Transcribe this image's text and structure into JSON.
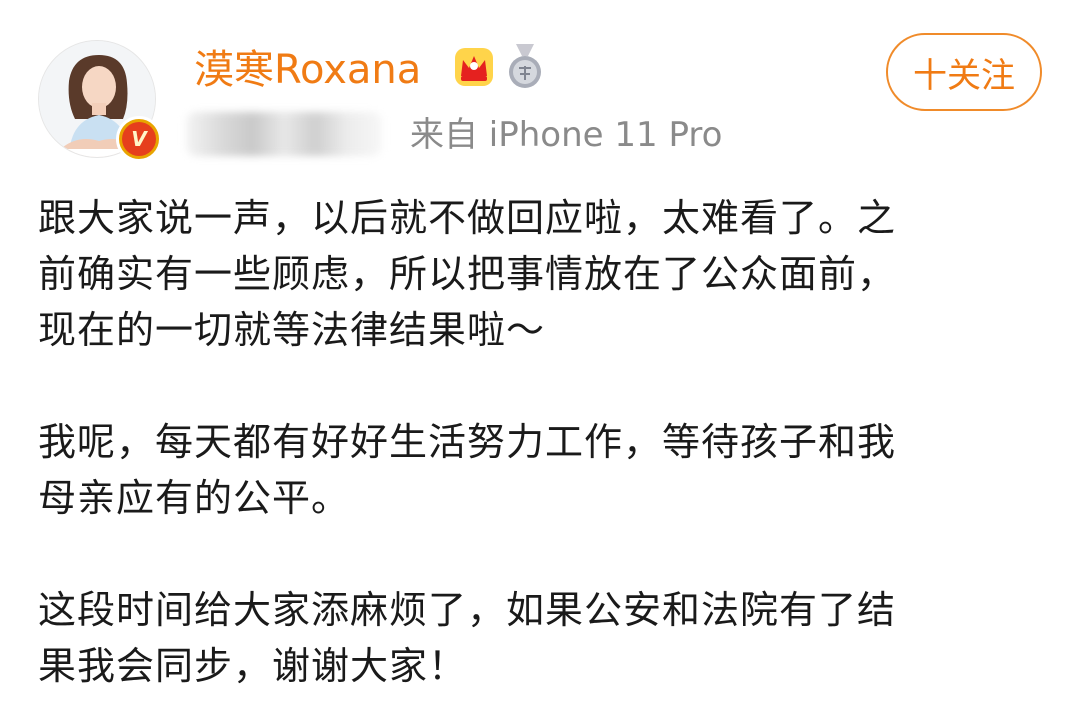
{
  "header": {
    "username": "漠寒Roxana",
    "follow_label": "十关注",
    "source": "来自 iPhone 11 Pro",
    "verified_mark": "V",
    "icons": {
      "crown": "crown-icon",
      "medal": "medal-icon",
      "verify": "verified-badge-icon"
    }
  },
  "post": {
    "paragraphs": [
      {
        "lines": [
          "跟大家说一声，以后就不做回应啦，太难看了。之",
          "前确实有一些顾虑，所以把事情放在了公众面前，",
          "现在的一切就等法律结果啦～"
        ]
      },
      {
        "lines": [
          "我呢，每天都有好好生活努力工作，等待孩子和我",
          "母亲应有的公平。"
        ]
      },
      {
        "lines": [
          "这段时间给大家添麻烦了，如果公安和法院有了结",
          "果我会同步，谢谢大家！"
        ]
      }
    ]
  },
  "colors": {
    "accent": "#f07b14",
    "text": "#1a1a1a",
    "muted": "#8a8a8a"
  }
}
